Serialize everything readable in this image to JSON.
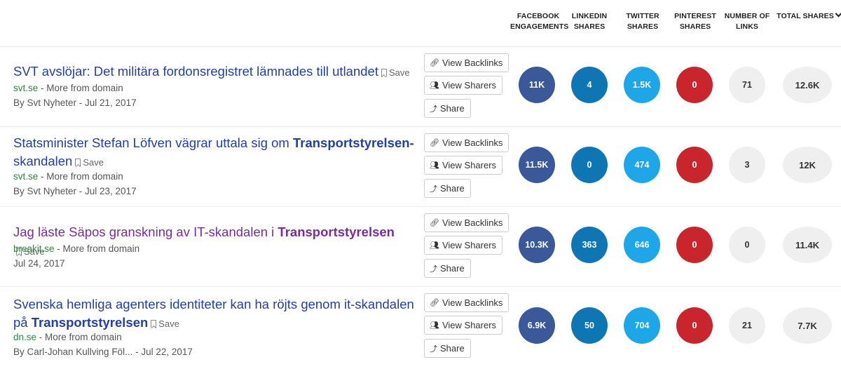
{
  "columns": {
    "facebook": [
      "FACEBOOK",
      "ENGAGEMENTS"
    ],
    "linkedin": [
      "LINKEDIN",
      "SHARES"
    ],
    "twitter": [
      "TWITTER",
      "SHARES"
    ],
    "pinterest": [
      "PINTEREST",
      "SHARES"
    ],
    "links": [
      "NUMBER OF",
      "LINKS"
    ],
    "total": "TOTAL SHARES"
  },
  "actions": {
    "backlinks": "View Backlinks",
    "sharers": "View Sharers",
    "share": "Share",
    "save": "Save"
  },
  "more_from_domain": "- More from domain",
  "colors": {
    "facebook": "#3b5998",
    "linkedin": "#0e76b3",
    "twitter": "#1da7e8",
    "pinterest": "#c9252c",
    "neutral": "#efefef",
    "link": "#2240a6",
    "visited_link": "#7b2ba0",
    "domain": "#2e8540"
  },
  "results": [
    {
      "title_text": "SVT avslöjar: Det militära fordonsregistret lämnades till utlandet",
      "title_bold": "",
      "domain": "svt.se",
      "byline": "By Svt Nyheter - Jul 21, 2017",
      "facebook": "11K",
      "linkedin": "4",
      "twitter": "1.5K",
      "pinterest": "0",
      "links": "71",
      "total": "12.6K"
    },
    {
      "title_text": "Statsminister Stefan Löfven vägrar uttala sig om ",
      "title_bold": "Transportstyrelsen-",
      "title_after": "skandalen",
      "domain": "svt.se",
      "byline": "By Svt Nyheter - Jul 23, 2017",
      "facebook": "11.5K",
      "linkedin": "0",
      "twitter": "474",
      "pinterest": "0",
      "links": "3",
      "total": "12K"
    },
    {
      "title_text": "Jag läste Säpos granskning av IT-skandalen i ",
      "title_bold": "Transportstyrelsen",
      "domain": "breakit.se",
      "byline": "Jul 24, 2017",
      "facebook": "10.3K",
      "linkedin": "363",
      "twitter": "646",
      "pinterest": "0",
      "links": "0",
      "total": "11.4K"
    },
    {
      "title_text": "Svenska hemliga agenters identiteter kan ha röjts genom it-skandalen på ",
      "title_bold": "Transportstyrelsen",
      "domain": "dn.se",
      "byline": "By Carl-Johan Kullving Föl... - Jul 22, 2017",
      "facebook": "6.9K",
      "linkedin": "50",
      "twitter": "704",
      "pinterest": "0",
      "links": "21",
      "total": "7.7K"
    }
  ]
}
